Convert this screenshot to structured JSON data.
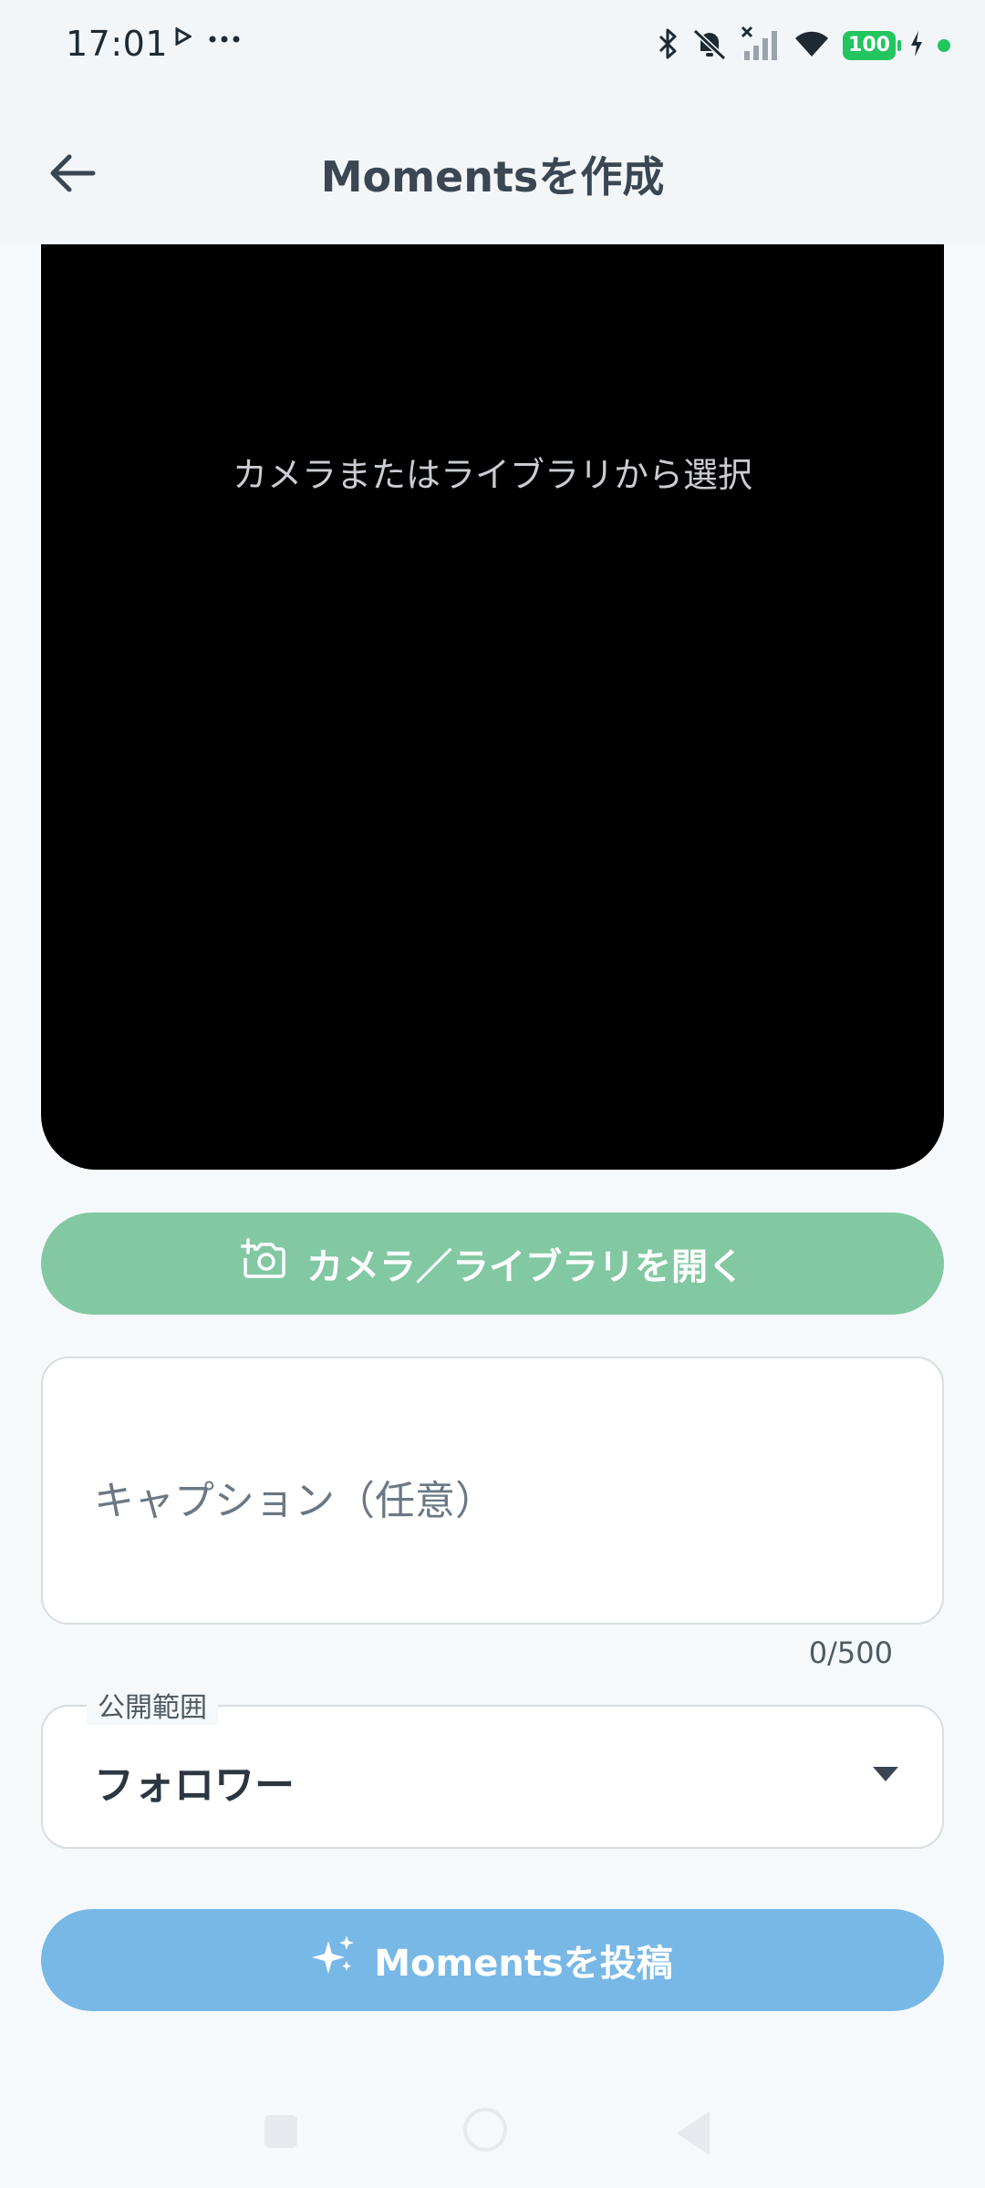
{
  "status_bar": {
    "time": "17:01",
    "battery": "100",
    "icons": [
      "play-icon",
      "more-icon",
      "bluetooth-icon",
      "bell-muted-icon",
      "signal-off-icon",
      "wifi-icon",
      "battery-icon",
      "charging-icon"
    ]
  },
  "header": {
    "title": "Momentsを作成",
    "back_icon": "back-arrow-icon"
  },
  "preview": {
    "hint": "カメラまたはライブラリから選択"
  },
  "open_camera_button": {
    "label": "カメラ／ライブラリを開く",
    "icon": "camera-add-icon"
  },
  "caption": {
    "placeholder": "キャプション（任意）",
    "value": "",
    "counter": "0/500"
  },
  "visibility": {
    "label": "公開範囲",
    "selected": "フォロワー"
  },
  "post_button": {
    "label": "Momentsを投稿",
    "icon": "sparkles-icon"
  },
  "colors": {
    "primary_green": "#82C8A2",
    "primary_blue": "#78B8E6",
    "battery_green": "#22C55E",
    "text_dark": "#3A4652"
  }
}
